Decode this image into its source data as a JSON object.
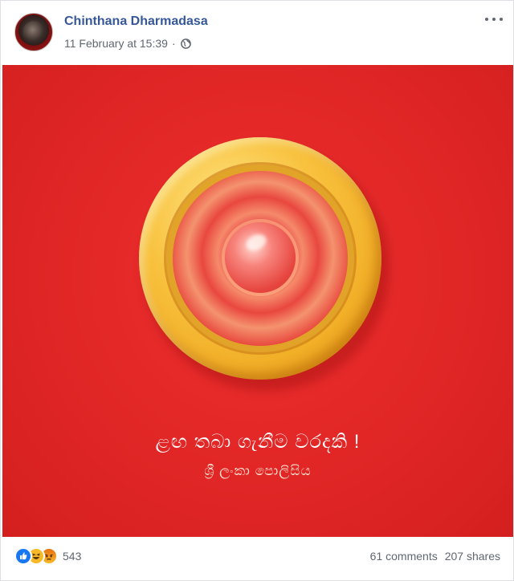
{
  "post": {
    "author": "Chinthana Dharmadasa",
    "timestamp": "11 February at 15:39",
    "separator": "·",
    "privacy_icon": "globe-icon",
    "menu_icon": "more-options-icon"
  },
  "image": {
    "caption_main": "ළඟ තබා ගැනීම වරදකි !",
    "caption_sub": "ශ්‍රී ලංකා පොලිසිය",
    "background_color": "#e12626"
  },
  "footer": {
    "reaction_icons": [
      "like-icon",
      "haha-icon",
      "angry-icon"
    ],
    "reaction_count": "543",
    "comments": "61 comments",
    "shares": "207 shares"
  },
  "colors": {
    "author_link": "#365899",
    "secondary_text": "#606770",
    "like_blue": "#1877f2"
  }
}
